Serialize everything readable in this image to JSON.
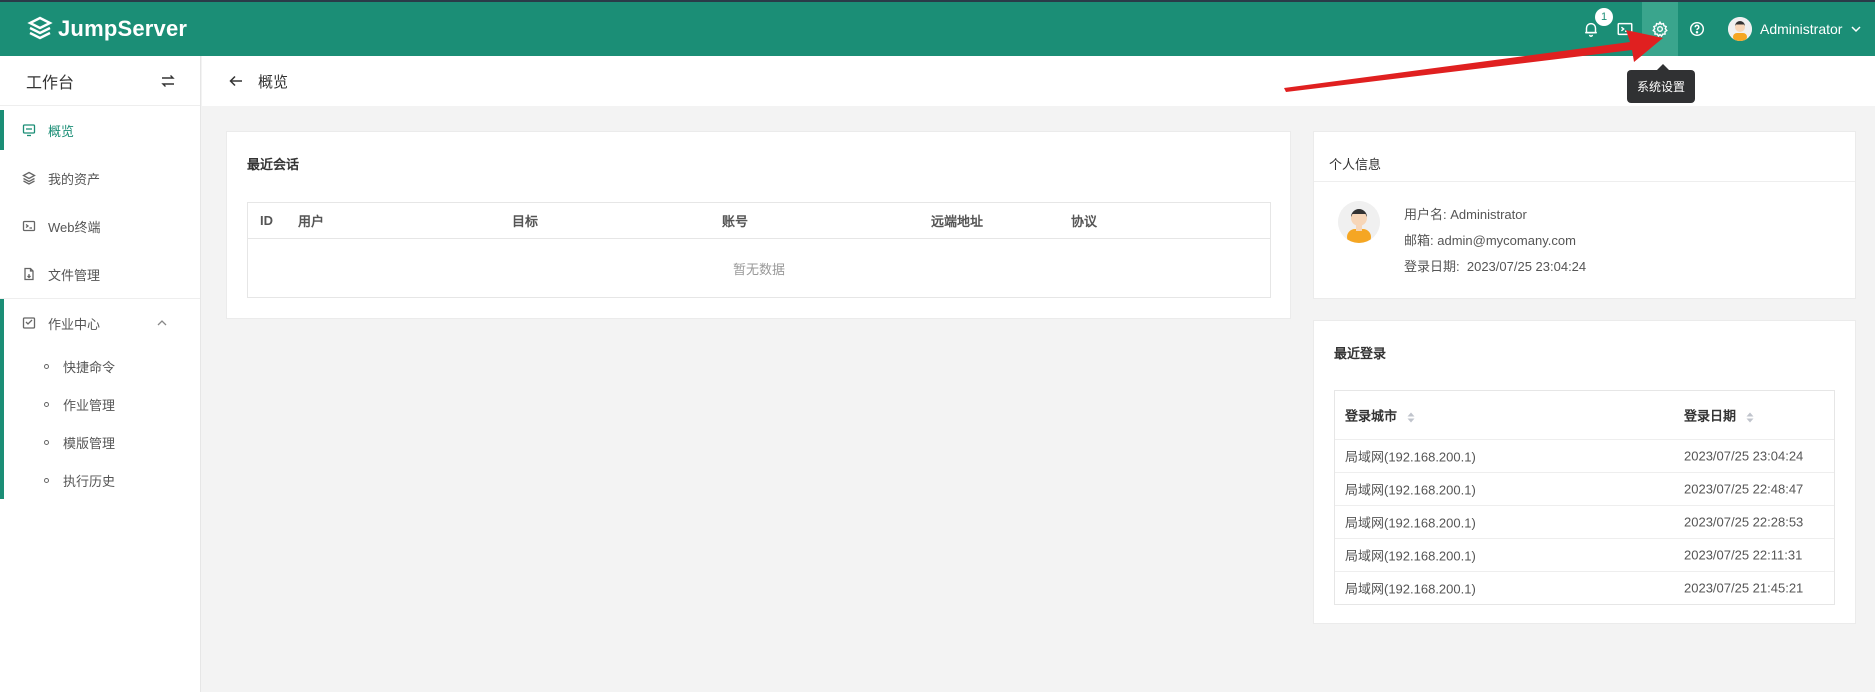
{
  "app": {
    "name": "JumpServer"
  },
  "topbar": {
    "notification_count": "1",
    "user_name": "Administrator",
    "tooltip": "系统设置"
  },
  "sidebar": {
    "title": "工作台",
    "items": [
      {
        "label": "概览",
        "icon": "monitor-icon"
      },
      {
        "label": "我的资产",
        "icon": "layers-icon"
      },
      {
        "label": "Web终端",
        "icon": "terminal-icon"
      },
      {
        "label": "文件管理",
        "icon": "file-icon"
      }
    ],
    "group": {
      "label": "作业中心",
      "icon": "task-icon",
      "children": [
        "快捷命令",
        "作业管理",
        "模版管理",
        "执行历史"
      ]
    }
  },
  "page": {
    "title": "概览"
  },
  "recent_sessions": {
    "title": "最近会话",
    "columns": [
      "ID",
      "用户",
      "目标",
      "账号",
      "远端地址",
      "协议"
    ],
    "empty_text": "暂无数据"
  },
  "profile": {
    "title": "个人信息",
    "username_label": "用户名:",
    "username": "Administrator",
    "email_label": "邮箱:",
    "email": "admin@mycomany.com",
    "login_date_label": "登录日期:",
    "login_date": "2023/07/25 23:04:24"
  },
  "recent_logins": {
    "title": "最近登录",
    "columns": [
      "登录城市",
      "登录日期"
    ],
    "rows": [
      [
        "局域网(192.168.200.1)",
        "2023/07/25 23:04:24"
      ],
      [
        "局域网(192.168.200.1)",
        "2023/07/25 22:48:47"
      ],
      [
        "局域网(192.168.200.1)",
        "2023/07/25 22:28:53"
      ],
      [
        "局域网(192.168.200.1)",
        "2023/07/25 22:11:31"
      ],
      [
        "局域网(192.168.200.1)",
        "2023/07/25 21:45:21"
      ]
    ]
  },
  "colors": {
    "brand": "#1b8e76",
    "annotation_arrow": "#e02020"
  }
}
